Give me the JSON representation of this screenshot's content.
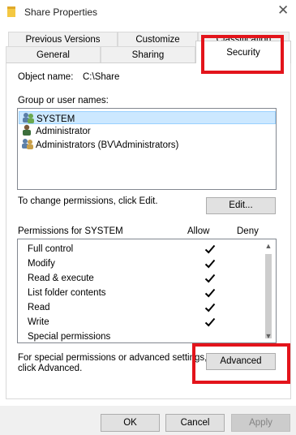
{
  "window": {
    "title": "Share Properties"
  },
  "tabs_row1": [
    "Previous Versions",
    "Customize",
    "Classification"
  ],
  "tabs_row2": [
    "General",
    "Sharing",
    "Security"
  ],
  "object": {
    "label": "Object name:",
    "value": "C:\\Share"
  },
  "groups": {
    "label": "Group or user names:",
    "items": [
      "SYSTEM",
      "Administrator",
      "Administrators (BV\\Administrators)"
    ],
    "selected_index": 0
  },
  "change_perm": {
    "text": "To change permissions, click Edit.",
    "edit_button": "Edit..."
  },
  "permissions": {
    "label": "Permissions for SYSTEM",
    "allow_header": "Allow",
    "deny_header": "Deny",
    "rows": [
      {
        "name": "Full control",
        "allow": true
      },
      {
        "name": "Modify",
        "allow": true
      },
      {
        "name": "Read & execute",
        "allow": true
      },
      {
        "name": "List folder contents",
        "allow": true
      },
      {
        "name": "Read",
        "allow": true
      },
      {
        "name": "Write",
        "allow": true
      },
      {
        "name": "Special permissions",
        "allow": false
      }
    ]
  },
  "advanced": {
    "text_line1": "For special permissions or advanced settings,",
    "text_line2": "click Advanced.",
    "button": "Advanced"
  },
  "dialog_buttons": {
    "ok": "OK",
    "cancel": "Cancel",
    "apply": "Apply"
  },
  "colors": {
    "highlight": "#e3141b",
    "selection": "#cce8ff"
  }
}
